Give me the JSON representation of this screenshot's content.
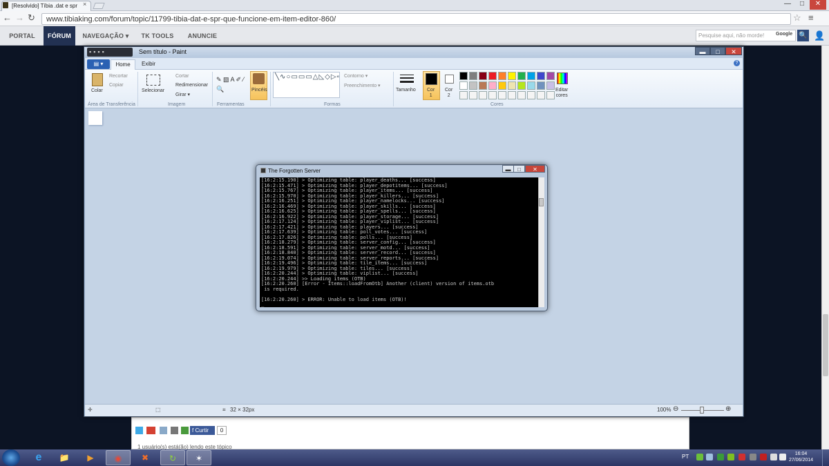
{
  "browser": {
    "tab_title": "[Resolvido] Tíbia .dat e spr",
    "tab_close": "×",
    "url": "www.tibiaking.com/forum/topic/11799-tibia-dat-e-spr-que-funcione-em-item-editor-860/",
    "nav_icons": {
      "back": "←",
      "forward": "→",
      "reload": "↻",
      "star": "☆",
      "menu": "≡"
    },
    "window_buttons": {
      "minimize": "—",
      "maximize": "□",
      "close": "✕"
    }
  },
  "site_nav": {
    "items": [
      "PORTAL",
      "FÓRUM",
      "NAVEGAÇÃO ▾",
      "TK TOOLS",
      "ANUNCIE"
    ],
    "active": "FÓRUM",
    "search_placeholder": "Pesquise aqui, não morde!",
    "search_engine": "Google",
    "search_icon": "🔍",
    "user_icon": "👤"
  },
  "paint": {
    "window_title": "Sem título - Paint",
    "quick_access": "▪▪▪▪",
    "window_buttons": {
      "minimize": "▬",
      "maximize": "□",
      "close": "✕"
    },
    "file_button": "▤ ▾",
    "tabs": [
      "Home",
      "Exibir"
    ],
    "help": "?",
    "clipboard": {
      "paste": "Colar",
      "cut": "Recortar",
      "copy": "Copiar",
      "group": "Área de Transferência"
    },
    "image": {
      "select": "Selecionar",
      "crop": "Cortar",
      "resize": "Redimensionar",
      "rotate": "Girar ▾",
      "group": "Imagem"
    },
    "tools": {
      "group": "Ferramentas",
      "glyphs": "✎ ▧ A ✐ ⁄ 🔍"
    },
    "brushes": "Pincéis",
    "shapes": {
      "glyphs": "╲∿○▭▭▭△◺◇▷⇨⇧⇩☆☆☆▢◯◯♡",
      "outline": "Contorno ▾",
      "fill": "Preenchimento ▾",
      "group": "Formas"
    },
    "size": "Tamanho",
    "color1": "Cor\n1",
    "color2": "Cor\n2",
    "edit_colors": "Editar\ncores",
    "colors_group": "Cores",
    "palette_row1": [
      "#000000",
      "#7f7f7f",
      "#880015",
      "#ed1c24",
      "#ff7f27",
      "#fff200",
      "#22b14c",
      "#00a2e8",
      "#3f48cc",
      "#a349a4"
    ],
    "palette_row2": [
      "#ffffff",
      "#c3c3c3",
      "#b97a57",
      "#ffaec9",
      "#ffc90e",
      "#efe4b0",
      "#b5e61d",
      "#99d9ea",
      "#7092be",
      "#c8bfe7"
    ],
    "status_size": "32 × 32px",
    "status_cursor_icon": "✛",
    "status_select_icon": "⬚",
    "status_size_icon": "⌗",
    "zoom": "100%",
    "zoom_minus": "⊖",
    "zoom_plus": "⊕"
  },
  "console": {
    "title": "The Forgotten Server",
    "window_buttons": {
      "minimize": "▬",
      "maximize": "□",
      "close": "✕"
    },
    "lines": [
      "[16:2:15.190] > Optimizing table: player_deaths... [success]",
      "[16:2:15.471] > Optimizing table: player_depotitems... [success]",
      "[16:2:15.767] > Optimizing table: player_items... [success]",
      "[16:2:15.970] > Optimizing table: player_killers... [success]",
      "[16:2:16.251] > Optimizing table: player_namelocks... [success]",
      "[16:2:16.469] > Optimizing table: player_skills... [success]",
      "[16:2:16.625] > Optimizing table: player_spells... [success]",
      "[16:2:16.922] > Optimizing table: player_storage... [success]",
      "[16:2:17.124] > Optimizing table: player_viplist... [success]",
      "[16:2:17.421] > Optimizing table: players... [success]",
      "[16:2:17.639] > Optimizing table: poll_votes... [success]",
      "[16:2:17.826] > Optimizing table: polls... [success]",
      "[16:2:18.279] > Optimizing table: server_config... [success]",
      "[16:2:18.591] > Optimizing table: server_motd... [success]",
      "[16:2:18.840] > Optimizing table: server_record... [success]",
      "[16:2:19.074] > Optimizing table: server_reports... [success]",
      "[16:2:19.496] > Optimizing table: tile_items... [success]",
      "[16:2:19.979] > Optimizing table: tiles... [success]",
      "[16:2:20.244] > Optimizing table: viplist... [success]",
      "[16:2:20.244] >> Loading items (OTB)",
      "[16:2:20.260] [Error - Items::loadFromOtb] Another (client) version of items.otb",
      " is required.",
      "",
      "[16:2:20.260] > ERROR: Unable to load items (OTB)!",
      "_"
    ]
  },
  "forum": {
    "like_button": "f Curtir",
    "like_count": "0",
    "reading_text": "1 usuário(s) está(ão) lendo este tópico"
  },
  "taskbar": {
    "apps": [
      "e",
      "📁",
      "▶",
      "◉",
      "✖",
      "↻",
      "✶"
    ],
    "language": "PT",
    "time": "16:04",
    "date": "27/06/2014"
  }
}
